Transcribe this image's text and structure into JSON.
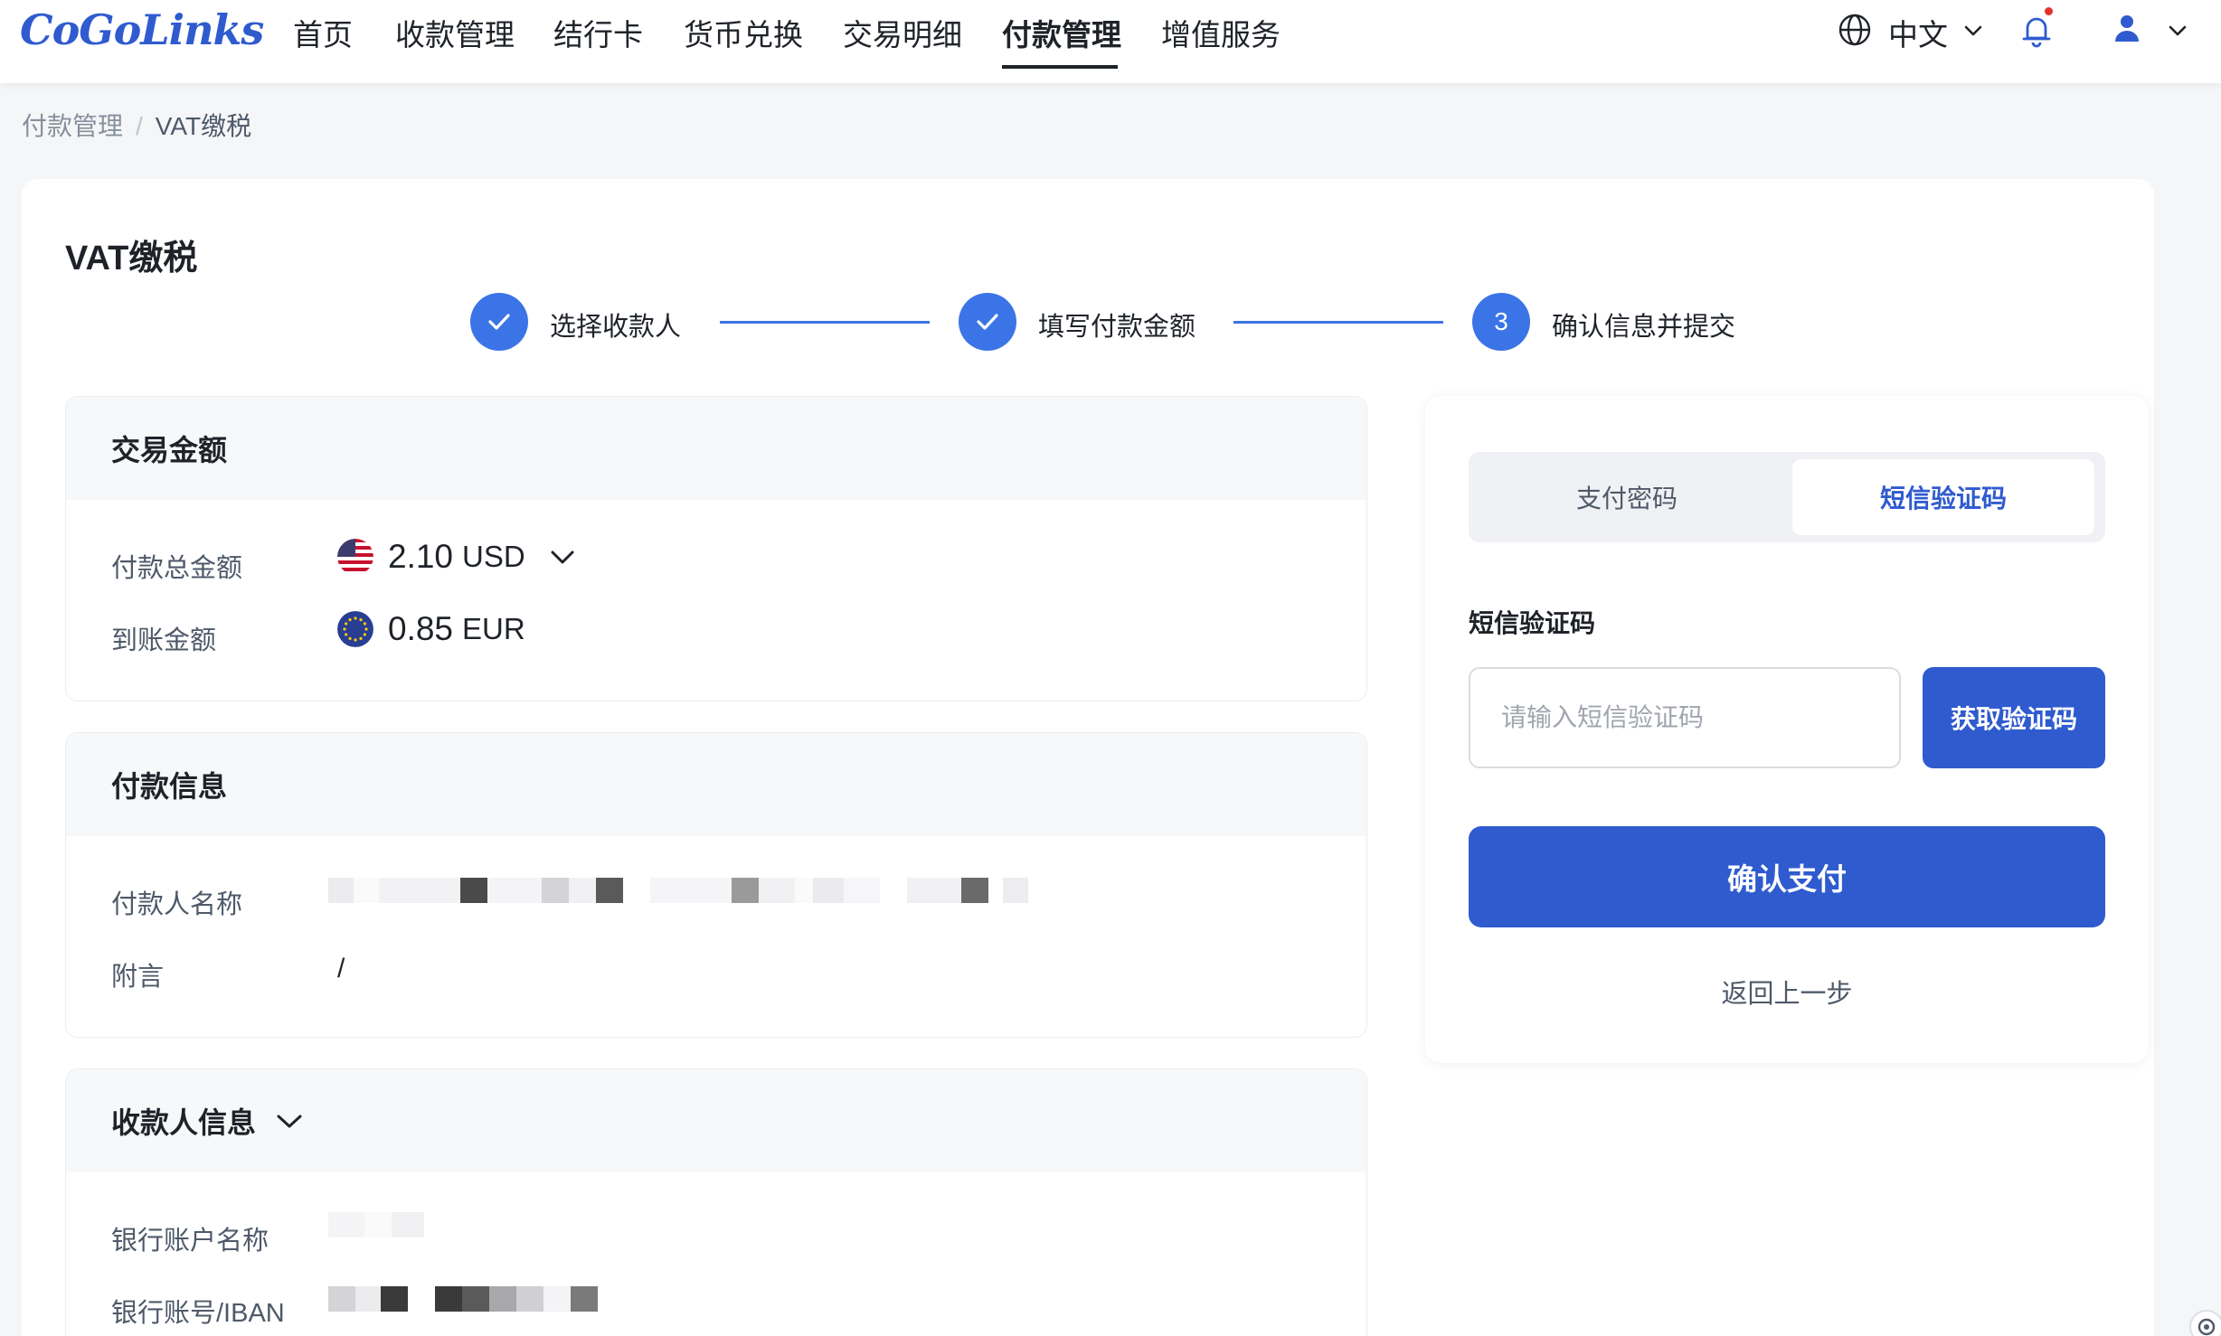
{
  "brand": {
    "logo_text": "CoGoLinks",
    "accent": "#2f5bcf"
  },
  "nav": {
    "items": [
      {
        "label": "首页",
        "active": false
      },
      {
        "label": "收款管理",
        "active": false
      },
      {
        "label": "结行卡",
        "active": false
      },
      {
        "label": "货币兑换",
        "active": false
      },
      {
        "label": "交易明细",
        "active": false
      },
      {
        "label": "付款管理",
        "active": true
      },
      {
        "label": "增值服务",
        "active": false
      }
    ],
    "language": "中文",
    "icons": [
      "globe-icon",
      "chevron-down-icon",
      "bell-icon",
      "user-icon"
    ]
  },
  "breadcrumb": {
    "parent": "付款管理",
    "separator": "/",
    "current": "VAT缴税"
  },
  "page": {
    "title": "VAT缴税"
  },
  "steps": [
    {
      "label": "选择收款人",
      "status": "done"
    },
    {
      "label": "填写付款金额",
      "status": "done"
    },
    {
      "number": "3",
      "label": "确认信息并提交",
      "status": "current"
    }
  ],
  "transaction": {
    "title": "交易金额",
    "total": {
      "label": "付款总金额",
      "value": "2.10",
      "currency": "USD",
      "flag": "us-flag-icon"
    },
    "received": {
      "label": "到账金额",
      "value": "0.85",
      "currency": "EUR",
      "flag": "eu-flag-icon"
    }
  },
  "payment_info": {
    "title": "付款信息",
    "payer_label": "付款人名称",
    "payer_value": "(obscured)",
    "memo_label": "附言",
    "memo_value": "/"
  },
  "payee_info": {
    "title": "收款人信息",
    "bank_name_label": "银行账户名称",
    "account_label": "银行账号/IBAN"
  },
  "verify": {
    "tabs": [
      {
        "label": "支付密码",
        "active": false
      },
      {
        "label": "短信验证码",
        "active": true
      }
    ],
    "field_label": "短信验证码",
    "input_placeholder": "请输入短信验证码",
    "input_value": "",
    "get_code_label": "获取验证码",
    "confirm_label": "确认支付",
    "back_label": "返回上一步"
  }
}
